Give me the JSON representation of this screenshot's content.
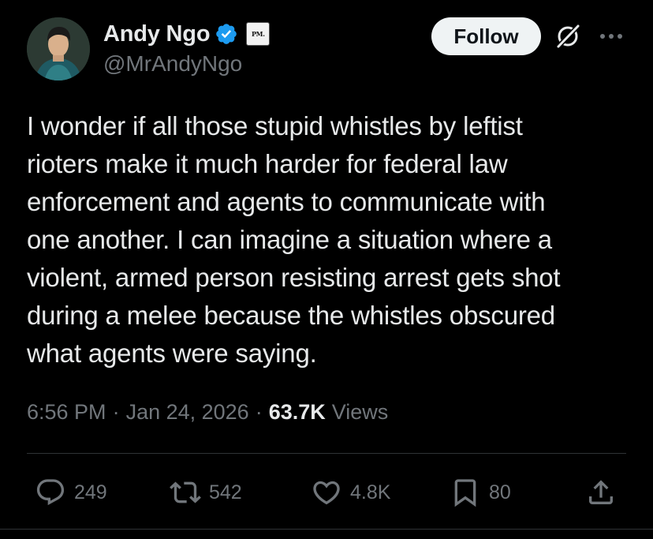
{
  "author": {
    "name": "Andy Ngo",
    "handle": "@MrAndyNgo",
    "affiliate_badge_text": "PM.",
    "verified_color": "#1d9bf0"
  },
  "header": {
    "follow_label": "Follow",
    "grok_icon": "grok-icon",
    "more_icon": "more-icon"
  },
  "tweet": {
    "text": "I wonder if all those stupid whistles by leftist\nrioters make it much harder for federal law\nenforcement and agents to communicate with\none another. I can imagine a situation where a\nviolent, armed person resisting arrest gets shot\nduring a melee because the whistles obscured\nwhat agents were saying."
  },
  "meta": {
    "time": "6:56 PM",
    "separator": "·",
    "date": "Jan 24, 2026",
    "views_count": "63.7K",
    "views_label": "Views"
  },
  "actions": {
    "replies": "249",
    "reposts": "542",
    "likes": "4.8K",
    "bookmarks": "80"
  },
  "colors": {
    "background": "#000000",
    "text": "#e7e9ea",
    "muted": "#71767b",
    "divider": "#2f3336",
    "follow_bg": "#eff3f4"
  }
}
